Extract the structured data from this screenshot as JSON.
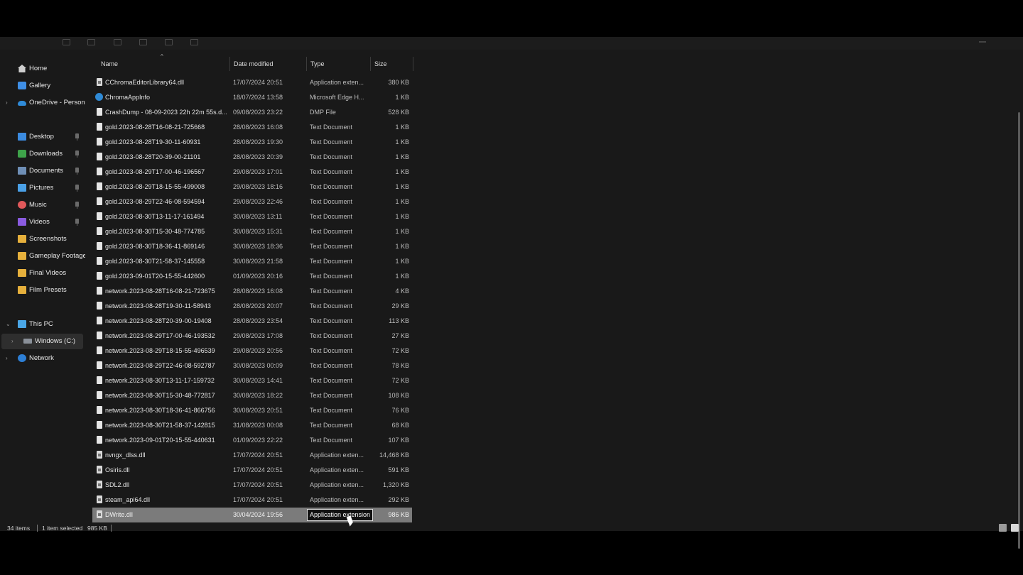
{
  "sidebar": {
    "items": [
      {
        "label": "Home",
        "icon": "home-icon",
        "group": "top"
      },
      {
        "label": "Gallery",
        "icon": "gallery-icon",
        "group": "top"
      },
      {
        "label": "OneDrive - Persona",
        "icon": "onedrive-icon",
        "group": "top",
        "expandable": true
      },
      {
        "label": "Desktop",
        "icon": "desktop-icon",
        "pinned": true
      },
      {
        "label": "Downloads",
        "icon": "downloads-icon",
        "pinned": true
      },
      {
        "label": "Documents",
        "icon": "documents-icon",
        "pinned": true
      },
      {
        "label": "Pictures",
        "icon": "pictures-icon",
        "pinned": true
      },
      {
        "label": "Music",
        "icon": "music-icon",
        "pinned": true
      },
      {
        "label": "Videos",
        "icon": "videos-icon",
        "pinned": true
      },
      {
        "label": "Screenshots",
        "icon": "folder-icon"
      },
      {
        "label": "Gameplay Footage",
        "icon": "folder-icon"
      },
      {
        "label": "Final Videos",
        "icon": "folder-icon"
      },
      {
        "label": "Film Presets",
        "icon": "folder-icon"
      },
      {
        "label": "This PC",
        "icon": "this-pc-icon",
        "expanded": true
      },
      {
        "label": "Windows (C:)",
        "icon": "drive-icon",
        "selected": true
      },
      {
        "label": "Network",
        "icon": "network-icon",
        "expandable": true
      }
    ]
  },
  "columns": {
    "name": "Name",
    "date": "Date modified",
    "type": "Type",
    "size": "Size"
  },
  "files": [
    {
      "name": "CChromaEditorLibrary64.dll",
      "date": "17/07/2024 20:51",
      "type": "Application exten...",
      "size": "380 KB",
      "icon": "dll"
    },
    {
      "name": "ChromaAppInfo",
      "date": "18/07/2024 13:58",
      "type": "Microsoft Edge H...",
      "size": "1 KB",
      "icon": "edge"
    },
    {
      "name": "CrashDump - 08-09-2023 22h 22m 55s.d...",
      "date": "09/08/2023 23:22",
      "type": "DMP File",
      "size": "528 KB",
      "icon": "file"
    },
    {
      "name": "gold.2023-08-28T16-08-21-725668",
      "date": "28/08/2023 16:08",
      "type": "Text Document",
      "size": "1 KB",
      "icon": "file"
    },
    {
      "name": "gold.2023-08-28T19-30-11-60931",
      "date": "28/08/2023 19:30",
      "type": "Text Document",
      "size": "1 KB",
      "icon": "file"
    },
    {
      "name": "gold.2023-08-28T20-39-00-21101",
      "date": "28/08/2023 20:39",
      "type": "Text Document",
      "size": "1 KB",
      "icon": "file"
    },
    {
      "name": "gold.2023-08-29T17-00-46-196567",
      "date": "29/08/2023 17:01",
      "type": "Text Document",
      "size": "1 KB",
      "icon": "file"
    },
    {
      "name": "gold.2023-08-29T18-15-55-499008",
      "date": "29/08/2023 18:16",
      "type": "Text Document",
      "size": "1 KB",
      "icon": "file"
    },
    {
      "name": "gold.2023-08-29T22-46-08-594594",
      "date": "29/08/2023 22:46",
      "type": "Text Document",
      "size": "1 KB",
      "icon": "file"
    },
    {
      "name": "gold.2023-08-30T13-11-17-161494",
      "date": "30/08/2023 13:11",
      "type": "Text Document",
      "size": "1 KB",
      "icon": "file"
    },
    {
      "name": "gold.2023-08-30T15-30-48-774785",
      "date": "30/08/2023 15:31",
      "type": "Text Document",
      "size": "1 KB",
      "icon": "file"
    },
    {
      "name": "gold.2023-08-30T18-36-41-869146",
      "date": "30/08/2023 18:36",
      "type": "Text Document",
      "size": "1 KB",
      "icon": "file"
    },
    {
      "name": "gold.2023-08-30T21-58-37-145558",
      "date": "30/08/2023 21:58",
      "type": "Text Document",
      "size": "1 KB",
      "icon": "file"
    },
    {
      "name": "gold.2023-09-01T20-15-55-442600",
      "date": "01/09/2023 20:16",
      "type": "Text Document",
      "size": "1 KB",
      "icon": "file"
    },
    {
      "name": "network.2023-08-28T16-08-21-723675",
      "date": "28/08/2023 16:08",
      "type": "Text Document",
      "size": "4 KB",
      "icon": "file"
    },
    {
      "name": "network.2023-08-28T19-30-11-58943",
      "date": "28/08/2023 20:07",
      "type": "Text Document",
      "size": "29 KB",
      "icon": "file"
    },
    {
      "name": "network.2023-08-28T20-39-00-19408",
      "date": "28/08/2023 23:54",
      "type": "Text Document",
      "size": "113 KB",
      "icon": "file"
    },
    {
      "name": "network.2023-08-29T17-00-46-193532",
      "date": "29/08/2023 17:08",
      "type": "Text Document",
      "size": "27 KB",
      "icon": "file"
    },
    {
      "name": "network.2023-08-29T18-15-55-496539",
      "date": "29/08/2023 20:56",
      "type": "Text Document",
      "size": "72 KB",
      "icon": "file"
    },
    {
      "name": "network.2023-08-29T22-46-08-592787",
      "date": "30/08/2023 00:09",
      "type": "Text Document",
      "size": "78 KB",
      "icon": "file"
    },
    {
      "name": "network.2023-08-30T13-11-17-159732",
      "date": "30/08/2023 14:41",
      "type": "Text Document",
      "size": "72 KB",
      "icon": "file"
    },
    {
      "name": "network.2023-08-30T15-30-48-772817",
      "date": "30/08/2023 18:22",
      "type": "Text Document",
      "size": "108 KB",
      "icon": "file"
    },
    {
      "name": "network.2023-08-30T18-36-41-866756",
      "date": "30/08/2023 20:51",
      "type": "Text Document",
      "size": "76 KB",
      "icon": "file"
    },
    {
      "name": "network.2023-08-30T21-58-37-142815",
      "date": "31/08/2023 00:08",
      "type": "Text Document",
      "size": "68 KB",
      "icon": "file"
    },
    {
      "name": "network.2023-09-01T20-15-55-440631",
      "date": "01/09/2023 22:22",
      "type": "Text Document",
      "size": "107 KB",
      "icon": "file"
    },
    {
      "name": "nvngx_dlss.dll",
      "date": "17/07/2024 20:51",
      "type": "Application exten...",
      "size": "14,468 KB",
      "icon": "dll"
    },
    {
      "name": "Osiris.dll",
      "date": "17/07/2024 20:51",
      "type": "Application exten...",
      "size": "591 KB",
      "icon": "dll"
    },
    {
      "name": "SDL2.dll",
      "date": "17/07/2024 20:51",
      "type": "Application exten...",
      "size": "1,320 KB",
      "icon": "dll"
    },
    {
      "name": "steam_api64.dll",
      "date": "17/07/2024 20:51",
      "type": "Application exten...",
      "size": "292 KB",
      "icon": "dll"
    },
    {
      "name": "DWrite.dll",
      "date": "30/04/2024 19:56",
      "type": "Application extension",
      "size": "986 KB",
      "icon": "dll",
      "selected": true
    }
  ],
  "status": {
    "count": "34 items",
    "selection": "1 item selected",
    "size": "985 KB"
  }
}
